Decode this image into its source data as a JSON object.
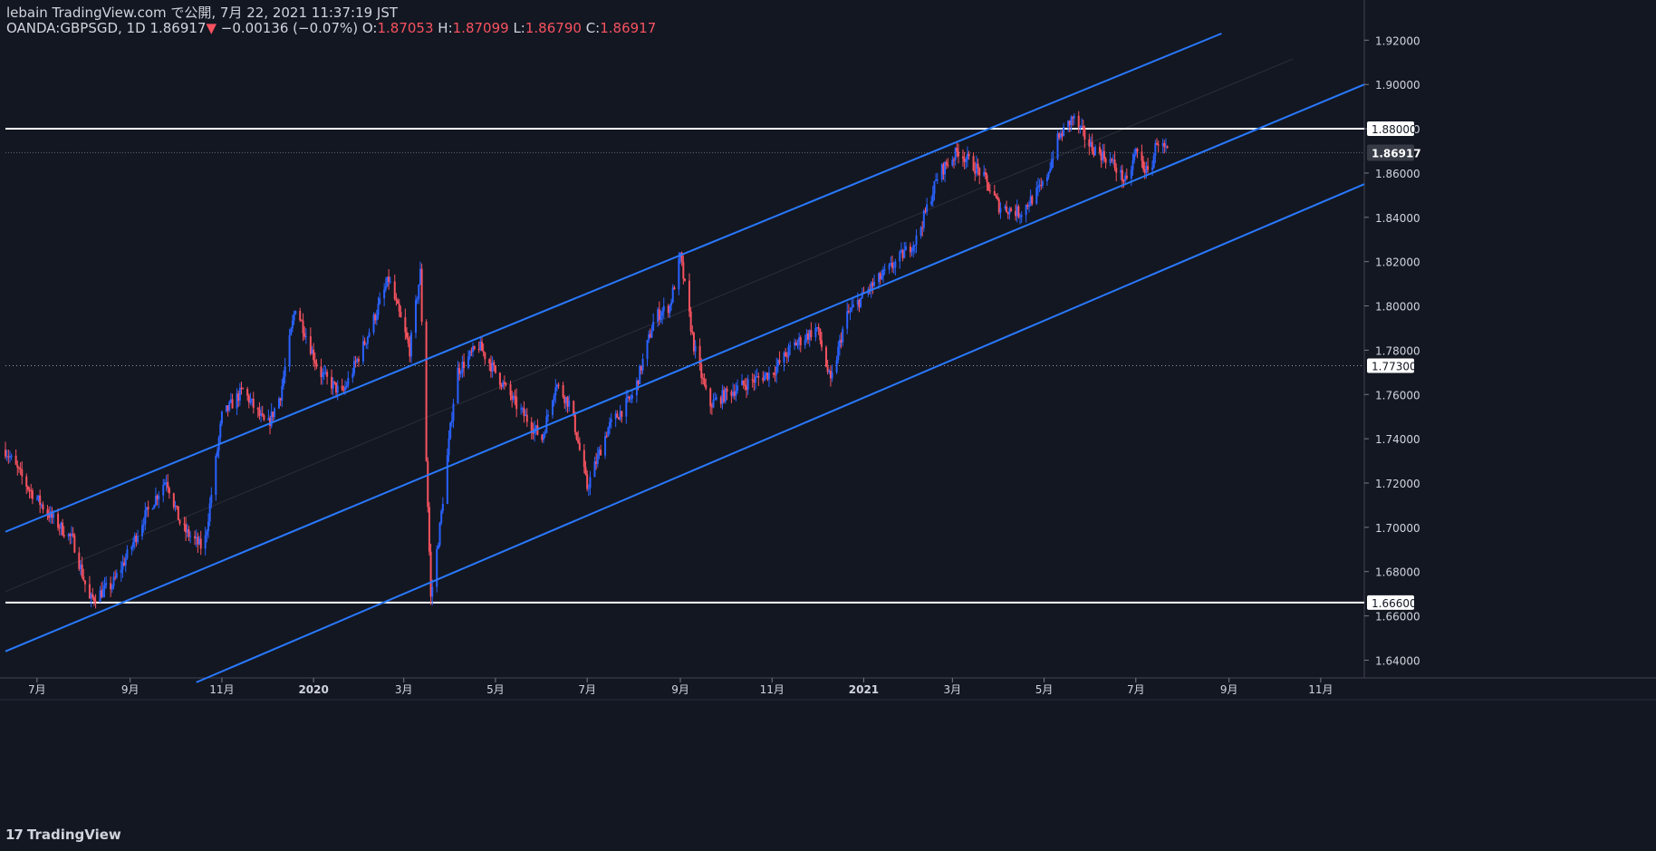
{
  "header": {
    "published": "lebain TradingView.com で公開, 7月 22, 2021 11:37:19 JST",
    "symbol": "OANDA:GBPSGD, 1D",
    "last": "1.86917",
    "change_arrow": "▼",
    "change": "−0.00136 (−0.07%)",
    "o_label": "O:",
    "o_value": "1.87053",
    "h_label": "H:",
    "h_value": "1.87099",
    "l_label": "L:",
    "l_value": "1.86790",
    "c_label": "C:",
    "c_value": "1.86917"
  },
  "footer": {
    "logo_glyph": "17",
    "brand": "TradingView"
  },
  "colors": {
    "background": "#131722",
    "up": "#2962ff",
    "down": "#f7525f",
    "channel": "#2979ff",
    "level": "#ffffff",
    "axis_text": "#d1d4dc",
    "label_bg": "#ffffff",
    "price_label_bg": "#363a45"
  },
  "chart_data": {
    "type": "candlestick",
    "title": "",
    "symbol": "OANDA:GBPSGD",
    "timeframe": "1D",
    "x_ticks": [
      "7月",
      "9月",
      "11月",
      "2020",
      "3月",
      "5月",
      "7月",
      "9月",
      "11月",
      "2021",
      "3月",
      "5月",
      "7月",
      "9月",
      "11月"
    ],
    "x_tick_dates": [
      "2019-07-01",
      "2019-09-01",
      "2019-11-01",
      "2020-01-01",
      "2020-03-01",
      "2020-05-01",
      "2020-07-01",
      "2020-09-01",
      "2020-11-01",
      "2021-01-01",
      "2021-03-01",
      "2021-05-01",
      "2021-07-01",
      "2021-09-01",
      "2021-11-01"
    ],
    "y_ticks": [
      "1.92000",
      "1.90000",
      "1.88000",
      "1.86000",
      "1.84000",
      "1.82000",
      "1.80000",
      "1.78000",
      "1.76000",
      "1.74000",
      "1.72000",
      "1.70000",
      "1.68000",
      "1.66000",
      "1.64000"
    ],
    "ylim": [
      1.632,
      1.923
    ],
    "current_price": "1.86917",
    "horizontal_levels": [
      {
        "value": 1.88,
        "label": "1.88000"
      },
      {
        "value": 1.666,
        "label": "1.66600"
      }
    ],
    "dotted_level": {
      "value": 1.773,
      "label": "1.77300"
    },
    "channel_lines": [
      {
        "name": "upper",
        "points": [
          [
            "2019-06-10",
            1.698
          ],
          [
            "2021-08-27",
            1.923
          ]
        ]
      },
      {
        "name": "middle",
        "points": [
          [
            "2019-06-10",
            1.644
          ],
          [
            "2021-11-30",
            1.9
          ]
        ]
      },
      {
        "name": "lower",
        "points": [
          [
            "2019-10-15",
            1.63
          ],
          [
            "2021-11-30",
            1.855
          ]
        ]
      }
    ],
    "price_path": [
      [
        "2019-06-10",
        1.735
      ],
      [
        "2019-06-25",
        1.718
      ],
      [
        "2019-07-10",
        1.705
      ],
      [
        "2019-07-25",
        1.694
      ],
      [
        "2019-08-05",
        1.667
      ],
      [
        "2019-08-20",
        1.674
      ],
      [
        "2019-09-01",
        1.69
      ],
      [
        "2019-09-10",
        1.704
      ],
      [
        "2019-09-25",
        1.722
      ],
      [
        "2019-10-05",
        1.7
      ],
      [
        "2019-10-20",
        1.69
      ],
      [
        "2019-11-01",
        1.75
      ],
      [
        "2019-11-15",
        1.762
      ],
      [
        "2019-12-01",
        1.745
      ],
      [
        "2019-12-10",
        1.76
      ],
      [
        "2019-12-20",
        1.8
      ],
      [
        "2020-01-05",
        1.77
      ],
      [
        "2020-01-20",
        1.76
      ],
      [
        "2020-02-05",
        1.785
      ],
      [
        "2020-02-20",
        1.812
      ],
      [
        "2020-03-05",
        1.78
      ],
      [
        "2020-03-12",
        1.815
      ],
      [
        "2020-03-19",
        1.668
      ],
      [
        "2020-03-25",
        1.7
      ],
      [
        "2020-04-05",
        1.77
      ],
      [
        "2020-04-20",
        1.782
      ],
      [
        "2020-05-01",
        1.77
      ],
      [
        "2020-05-15",
        1.755
      ],
      [
        "2020-06-01",
        1.74
      ],
      [
        "2020-06-10",
        1.765
      ],
      [
        "2020-06-20",
        1.755
      ],
      [
        "2020-07-01",
        1.718
      ],
      [
        "2020-07-15",
        1.745
      ],
      [
        "2020-08-01",
        1.76
      ],
      [
        "2020-08-15",
        1.795
      ],
      [
        "2020-08-25",
        1.8
      ],
      [
        "2020-09-01",
        1.822
      ],
      [
        "2020-09-10",
        1.782
      ],
      [
        "2020-09-20",
        1.755
      ],
      [
        "2020-10-01",
        1.76
      ],
      [
        "2020-10-15",
        1.765
      ],
      [
        "2020-11-01",
        1.77
      ],
      [
        "2020-11-15",
        1.782
      ],
      [
        "2020-12-01",
        1.79
      ],
      [
        "2020-12-10",
        1.765
      ],
      [
        "2020-12-20",
        1.795
      ],
      [
        "2021-01-05",
        1.808
      ],
      [
        "2021-01-20",
        1.818
      ],
      [
        "2021-02-05",
        1.83
      ],
      [
        "2021-02-20",
        1.86
      ],
      [
        "2021-03-05",
        1.87
      ],
      [
        "2021-03-20",
        1.86
      ],
      [
        "2021-04-01",
        1.845
      ],
      [
        "2021-04-15",
        1.842
      ],
      [
        "2021-05-01",
        1.855
      ],
      [
        "2021-05-10",
        1.875
      ],
      [
        "2021-05-20",
        1.885
      ],
      [
        "2021-06-01",
        1.872
      ],
      [
        "2021-06-15",
        1.865
      ],
      [
        "2021-06-25",
        1.855
      ],
      [
        "2021-07-01",
        1.87
      ],
      [
        "2021-07-10",
        1.858
      ],
      [
        "2021-07-15",
        1.875
      ],
      [
        "2021-07-22",
        1.869
      ]
    ]
  }
}
